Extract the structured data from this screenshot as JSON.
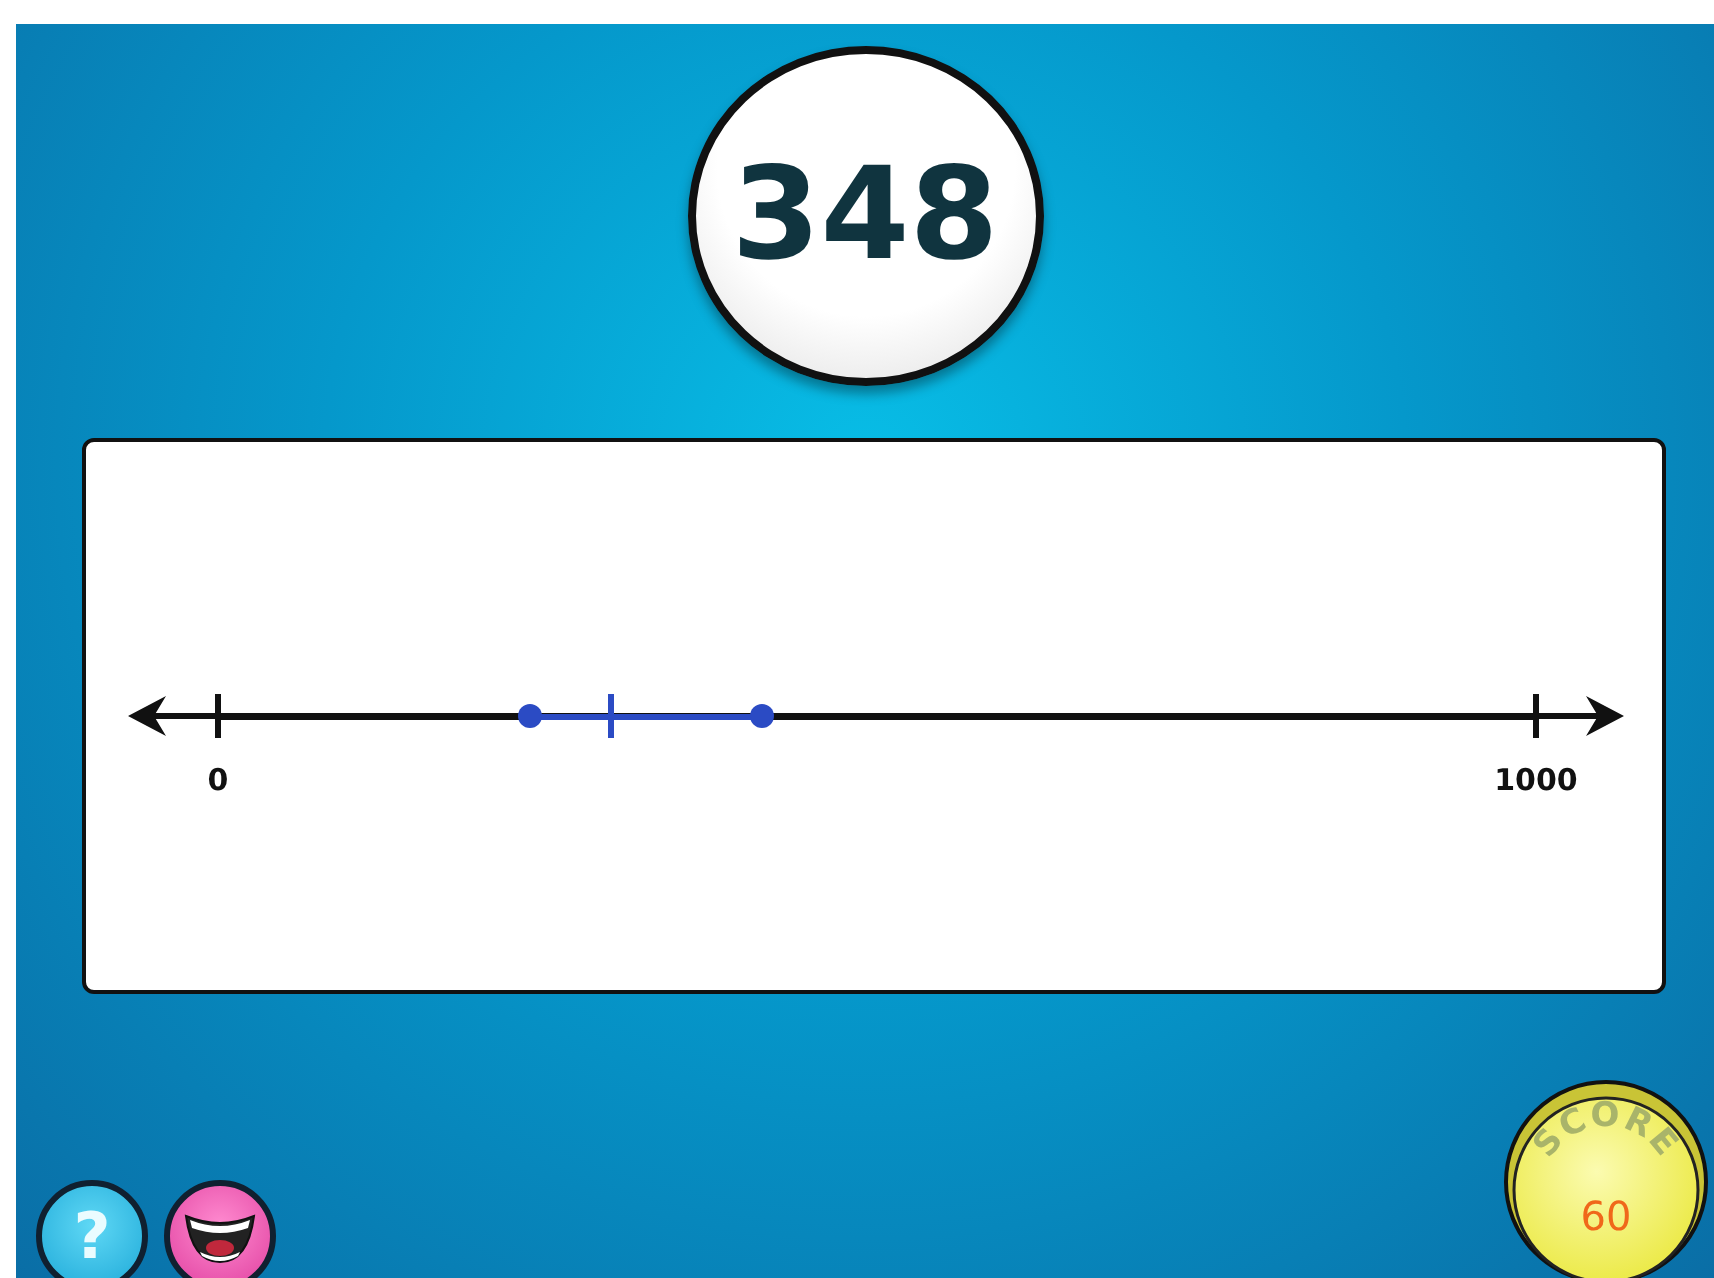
{
  "target": {
    "number": "348"
  },
  "number_line": {
    "start_label": "0",
    "end_label": "1000",
    "interval_start": {
      "level": 0.237
    },
    "interval_end": {
      "level": 0.412
    },
    "marker": {
      "level": 0.298
    }
  },
  "buttons": [
    {
      "kind": "help",
      "label": "?"
    },
    {
      "kind": "laugh"
    }
  ],
  "score": {
    "title": "SCORE",
    "value": "60"
  }
}
